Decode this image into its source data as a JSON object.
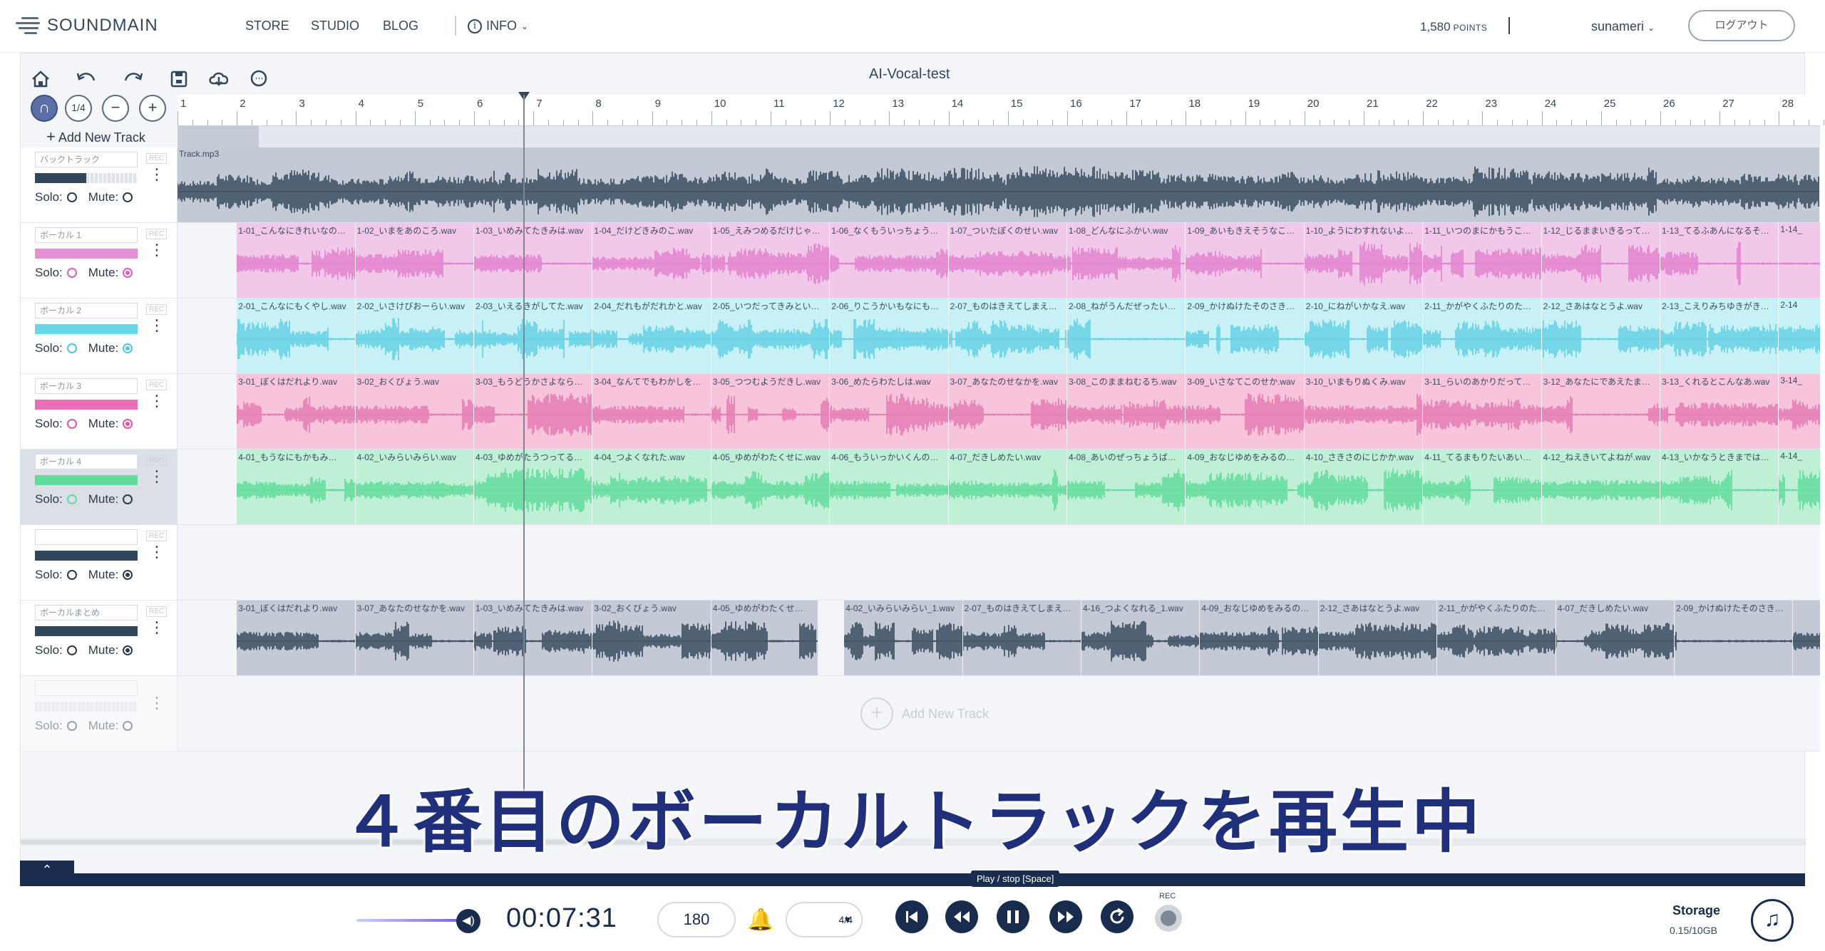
{
  "nav": {
    "logo": "SOUNDMAIN",
    "links": [
      "STORE",
      "STUDIO",
      "BLOG"
    ],
    "info": "INFO",
    "points_value": "1,580",
    "points_unit": "POINTS",
    "username": "sunameri",
    "logout": "ログアウト"
  },
  "toolbar": {
    "project_title": "AI-Vocal-test",
    "icons": [
      "home-icon",
      "undo-icon",
      "redo-icon",
      "save-icon",
      "download-icon",
      "comment-icon"
    ],
    "ctrl_magnet": "∩",
    "ctrl_quant": "1/4",
    "ctrl_minus": "−",
    "ctrl_plus": "+",
    "add_track": "Add New Track"
  },
  "ruler": [
    "1",
    "2",
    "3",
    "4",
    "5",
    "6",
    "7",
    "8",
    "9",
    "10",
    "11",
    "12",
    "13",
    "14",
    "15",
    "16",
    "17",
    "18",
    "19",
    "20",
    "21",
    "22",
    "23",
    "24",
    "25",
    "26",
    "27",
    "28"
  ],
  "playhead_bar": 6.4,
  "tracks": [
    {
      "name": "バックトラック",
      "rec": "REC",
      "solo": "Solo:",
      "mute": "Mute:",
      "vol": 0.5,
      "vol_color": "#33475b",
      "solo_on": false,
      "mute_on": false,
      "mute_color": "#2b3a4f",
      "clips": [
        {
          "label": "Track.mp3",
          "start": 0,
          "width": 28
        }
      ],
      "color": "#c3cad6",
      "wave": "#33475b",
      "start_offset": 0
    },
    {
      "name": "ボーカル 1",
      "rec": "REC",
      "solo": "Solo:",
      "mute": "Mute:",
      "vol": 1.0,
      "vol_color": "#e58fd4",
      "solo_on": false,
      "mute_on": true,
      "mute_color": "#d75fc0",
      "clips": [
        {
          "label": "1-01_こんなにきれいなの…"
        },
        {
          "label": "1-02_いまをあのころ.wav"
        },
        {
          "label": "1-03_いめみてたきみは.wav"
        },
        {
          "label": "1-04_だけどきみのこ.wav"
        },
        {
          "label": "1-05_えみつめるだけじゃ…"
        },
        {
          "label": "1-06_なくもういっちょう…"
        },
        {
          "label": "1-07_ついたぼくのせい.wav"
        },
        {
          "label": "1-08_どんなにふかい.wav"
        },
        {
          "label": "1-09_あいもきえそうなこ…"
        },
        {
          "label": "1-10_ようにわすれないよ…"
        },
        {
          "label": "1-11_いつのまにかもうこ…"
        },
        {
          "label": "1-12_じるままいきるって…"
        },
        {
          "label": "1-13_てるふあんになるそ…"
        },
        {
          "label": "1-14_"
        }
      ],
      "color": "#f2c8ea",
      "wave": "#e27fcd"
    },
    {
      "name": "ボーカル 2",
      "rec": "REC",
      "solo": "Solo:",
      "mute": "Mute:",
      "vol": 1.0,
      "vol_color": "#67d6e6",
      "solo_on": false,
      "mute_on": true,
      "mute_color": "#4cc4dc",
      "clips": [
        {
          "label": "2-01_こんなにもくやし.wav"
        },
        {
          "label": "2-02_いさけびおーらい.wav"
        },
        {
          "label": "2-03_いえるきがしてた.wav"
        },
        {
          "label": "2-04_だれもがだれかと.wav"
        },
        {
          "label": "2-05_いつだってきみとい…"
        },
        {
          "label": "2-06_りこうかいもなにも…"
        },
        {
          "label": "2-07_ものはきえてしまえ…"
        },
        {
          "label": "2-08_ねがうんだぜったい…"
        },
        {
          "label": "2-09_かけぬけたそのさき…"
        },
        {
          "label": "2-10_にねがいかなえ.wav"
        },
        {
          "label": "2-11_かがやくふたりのた…"
        },
        {
          "label": "2-12_さあはなとうよ.wav"
        },
        {
          "label": "2-13_こえりみちゆきがき…"
        },
        {
          "label": "2-14"
        }
      ],
      "color": "#c8f1f7",
      "wave": "#5fd0e3"
    },
    {
      "name": "ボーカル 3",
      "rec": "REC",
      "solo": "Solo:",
      "mute": "Mute:",
      "vol": 1.0,
      "vol_color": "#e96fb6",
      "solo_on": false,
      "mute_on": true,
      "mute_color": "#e0579f",
      "clips": [
        {
          "label": "3-01_ぼくはだれより.wav"
        },
        {
          "label": "3-02_おくびょう.wav"
        },
        {
          "label": "3-03_もうどうかさよなら…"
        },
        {
          "label": "3-04_なんてでもわかしを…"
        },
        {
          "label": "3-05_つつむようだきし.wav"
        },
        {
          "label": "3-06_めたらわたしは.wav"
        },
        {
          "label": "3-07_あなたのせなかを.wav"
        },
        {
          "label": "3-08_このままねむるち.wav"
        },
        {
          "label": "3-09_いさなてこのせか.wav"
        },
        {
          "label": "3-10_いまもりぬくみ.wav"
        },
        {
          "label": "3-11_らいのあかりだって…"
        },
        {
          "label": "3-12_あなたにであえたま…"
        },
        {
          "label": "3-13_くれるとこんなあ.wav"
        },
        {
          "label": "3-14_"
        }
      ],
      "color": "#f7c4dc",
      "wave": "#e47ab2"
    },
    {
      "name": "ボーカル 4",
      "rec": "REC",
      "solo": "Solo:",
      "mute": "Mute:",
      "vol": 1.0,
      "vol_color": "#5fdc9c",
      "solo_on": false,
      "mute_on": false,
      "mute_color": "#5fdc9c",
      "clips": [
        {
          "label": "4-01_もうなにもかもみ…"
        },
        {
          "label": "4-02_いみらいみらい.wav"
        },
        {
          "label": "4-03_ゆめがたうつってる…"
        },
        {
          "label": "4-04_つよくなれた.wav"
        },
        {
          "label": "4-05_ゆめがわたくせに.wav"
        },
        {
          "label": "4-06_もういっかいくんの…"
        },
        {
          "label": "4-07_だきしめたい.wav"
        },
        {
          "label": "4-08_あいのぜっちょうば…"
        },
        {
          "label": "4-09_おなじゆめをみるの…"
        },
        {
          "label": "4-10_さきさのにじかか.wav"
        },
        {
          "label": "4-11_てるまもりたいあい…"
        },
        {
          "label": "4-12_ねえきいてよねが.wav"
        },
        {
          "label": "4-13_いかなうときまでは…"
        },
        {
          "label": "4-14_"
        }
      ],
      "color": "#bff0d6",
      "wave": "#5edb9a"
    },
    {
      "name": "",
      "rec": "REC",
      "solo": "Solo:",
      "mute": "Mute:",
      "vol": 1.0,
      "vol_color": "#33475b",
      "solo_on": false,
      "mute_on": true,
      "mute_color": "#2b3a4f",
      "clips": [],
      "color": "#f3f5f8",
      "wave": "#33475b"
    },
    {
      "name": "ボーカルまとめ",
      "rec": "REC",
      "solo": "Solo:",
      "mute": "Mute:",
      "vol": 1.0,
      "vol_color": "#33475b",
      "solo_on": false,
      "mute_on": true,
      "mute_color": "#2b3a4f",
      "clips": [
        {
          "label": "3-01_ぼくはだれより.wav"
        },
        {
          "label": "3-07_あなたのせなかを.wav"
        },
        {
          "label": "1-03_いめみてたきみは.wav"
        },
        {
          "label": "3-02_おくびょう.wav"
        },
        {
          "label": "4-05_ゆめがわたくせ…",
          "short": true
        },
        {
          "label": "4-02_いみらいみらい_1.wav",
          "gap": true
        },
        {
          "label": "2-07_ものはきえてしまえ…"
        },
        {
          "label": "4-16_つよくなれる_1.wav"
        },
        {
          "label": "4-09_おなじゆめをみるの…"
        },
        {
          "label": "2-12_さあはなとうよ.wav"
        },
        {
          "label": "2-11_かがやくふたりのた…"
        },
        {
          "label": "4-07_だきしめたい.wav"
        },
        {
          "label": "2-09_かけぬけたそのさき…"
        },
        {
          "label": ""
        }
      ],
      "color": "#c3cad6",
      "wave": "#33475b"
    },
    {
      "name": "",
      "rec": "",
      "solo": "Solo:",
      "mute": "Mute:",
      "vol": 0,
      "vol_color": "#c5ccd6",
      "solo_on": false,
      "mute_on": false,
      "mute_color": "#2b3a4f",
      "clips": [],
      "color": "#f3f5f8",
      "wave": "#33475b",
      "ghost": true
    }
  ],
  "lane_add": "Add New Track",
  "subtitle": "４番目のボーカルトラックを再生中",
  "transport": {
    "time": "00:07:31",
    "bpm": "180",
    "meter": "4/4",
    "tooltip": "Play / stop [Space]",
    "rec": "REC",
    "storage_label": "Storage",
    "storage_value": "0.15/10GB"
  }
}
